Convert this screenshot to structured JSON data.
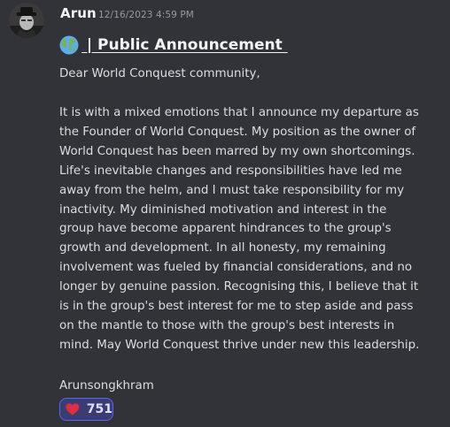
{
  "message": {
    "author": "Arun",
    "timestamp": "12/16/2023 4:59 PM",
    "heading": " | Public Announcement ",
    "greeting": "Dear World Conquest community,",
    "body_lines": [
      "It is with a mixed emotions that I announce my departure as",
      "the Founder of World Conquest. My position as the owner of",
      "World Conquest has been marred by my own shortcomings.",
      "Life's inevitable changes and responsibilities have led me",
      "away from the helm, and I must take responsibility for my",
      "inactivity. My diminished motivation and interest in the",
      "group have become apparent hindrances to the group's",
      "growth and development. In all honesty, my remaining",
      "involvement was fueled by financial considerations, and no",
      "longer by genuine passion. Recognising this, I believe that it",
      "is in the group's best interest for me to step aside and pass",
      "on the mantle to those with the group's best interests in",
      "mind. May World Conquest thrive under new this leadership."
    ],
    "signature": "Arunsongkhram"
  },
  "reaction": {
    "icon": "heart-icon",
    "count": "751",
    "color": "#dd2e44"
  },
  "icons": {
    "heading": "globe-icon"
  },
  "colors": {
    "background": "#313338",
    "text": "#dbdee1",
    "reaction_border": "#5865f2",
    "reaction_bg": "#3b3d72"
  }
}
